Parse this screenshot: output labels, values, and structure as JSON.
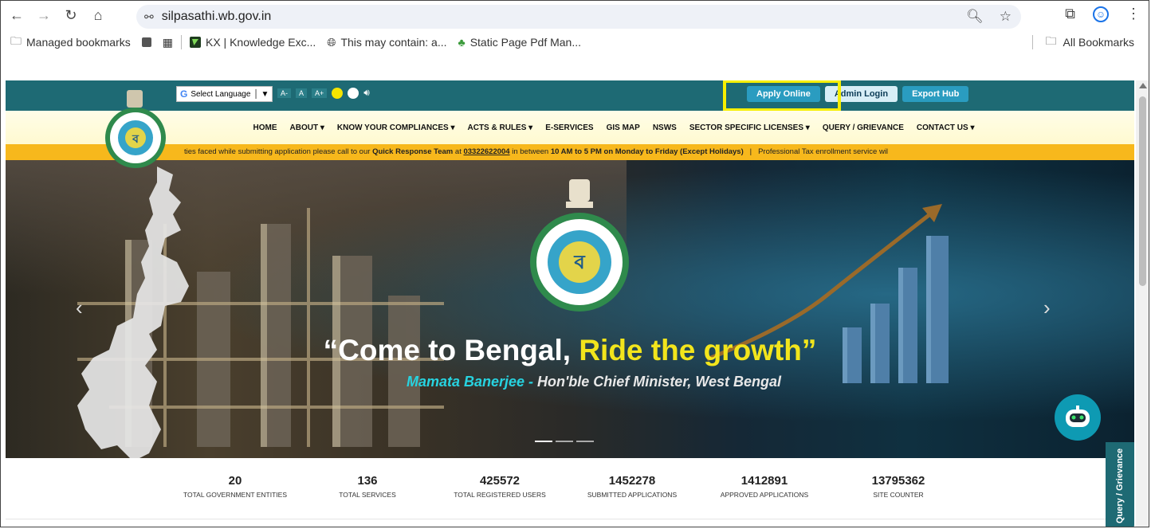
{
  "browser": {
    "url": "silpasathi.wb.gov.in",
    "bookmarks": [
      {
        "label": "Managed bookmarks"
      },
      {
        "label": "KX | Knowledge Exc..."
      },
      {
        "label": "This may contain: a..."
      },
      {
        "label": "Static Page Pdf Man..."
      }
    ],
    "all_bookmarks": "All Bookmarks"
  },
  "topbar": {
    "language_label": "Select Language",
    "font_small": "A-",
    "font_normal": "A",
    "font_large": "A+",
    "buttons": [
      "Apply Online",
      "Admin Login",
      "Export Hub"
    ]
  },
  "menu": [
    "HOME",
    "ABOUT ▾",
    "KNOW YOUR COMPLIANCES ▾",
    "ACTS & RULES ▾",
    "E-SERVICES",
    "GIS MAP",
    "NSWS",
    "SECTOR SPECIFIC LICENSES ▾",
    "QUERY / GRIEVANCE",
    "CONTACT US ▾"
  ],
  "ticker": {
    "part1": "ties faced while submitting application please call to our ",
    "team": "Quick Response Team",
    "part2": " at ",
    "phone": "03322622004",
    "part3": " in between ",
    "hours": "10 AM to 5 PM on Monday to Friday (Except Holidays)",
    "part4": "   |   Professional Tax enrollment service wil"
  },
  "hero": {
    "headline_a": "“Come to Bengal, ",
    "headline_b": "Ride the growth”",
    "sub_name": "Mamata Banerjee -",
    "sub_rest": " Hon'ble Chief Minister, West Bengal"
  },
  "stats": [
    {
      "value": "20",
      "label": "TOTAL GOVERNMENT ENTITIES"
    },
    {
      "value": "136",
      "label": "TOTAL SERVICES"
    },
    {
      "value": "425572",
      "label": "TOTAL REGISTERED USERS"
    },
    {
      "value": "1452278",
      "label": "SUBMITTED APPLICATIONS"
    },
    {
      "value": "1412891",
      "label": "APPROVED APPLICATIONS"
    },
    {
      "value": "13795362",
      "label": "SITE COUNTER"
    }
  ],
  "side_tab": "Query / Grievance"
}
